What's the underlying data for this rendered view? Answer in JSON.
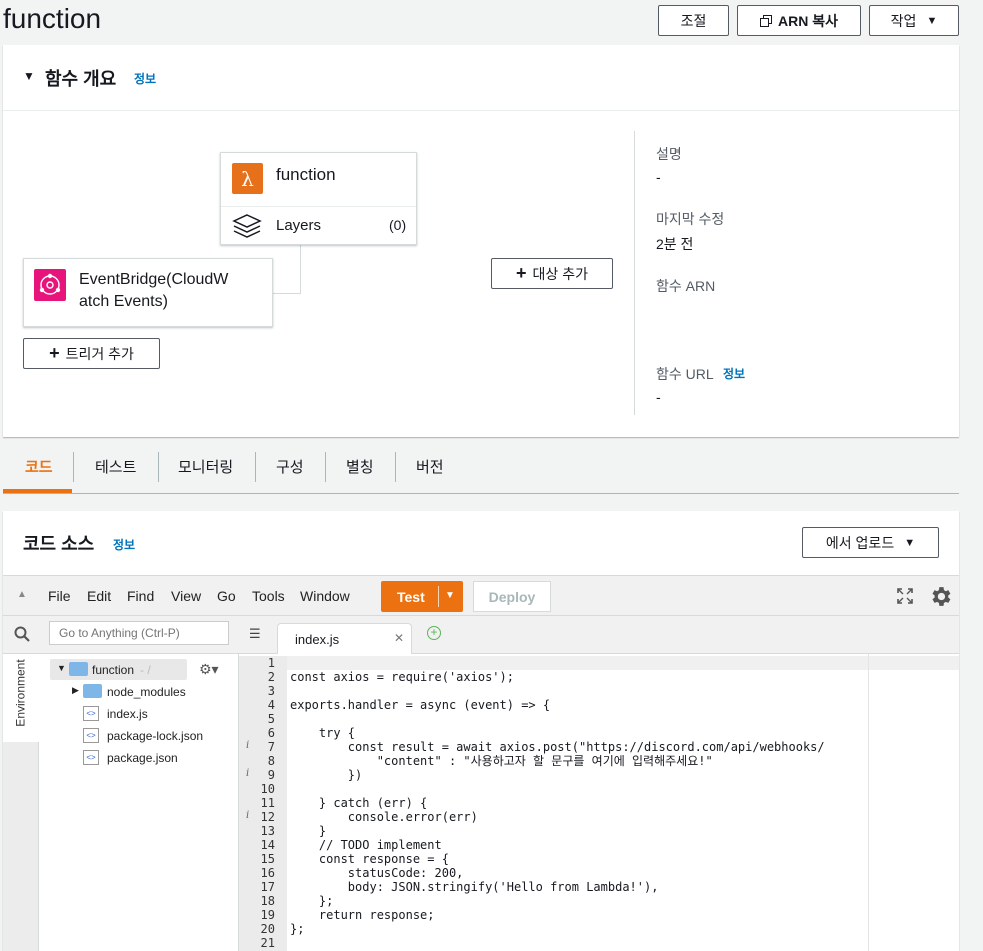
{
  "page": {
    "title": "function"
  },
  "header_buttons": {
    "throttle": "조절",
    "copy_arn": "ARN 복사",
    "actions": "작업"
  },
  "overview": {
    "heading": "함수 개요",
    "info": "정보",
    "function_name": "function",
    "layers_label": "Layers",
    "layers_count": "(0)",
    "trigger_name": "EventBridge(CloudWatch Events)",
    "trigger_line1": "EventBridge(CloudW",
    "trigger_line2": "atch Events)",
    "add_trigger": "트리거 추가",
    "add_destination": "대상 추가",
    "description_label": "설명",
    "description_value": "-",
    "last_modified_label": "마지막 수정",
    "last_modified_value": "2분 전",
    "arn_label": "함수 ARN",
    "url_label": "함수 URL",
    "url_info": "정보",
    "url_value": "-"
  },
  "tabs": [
    "코드",
    "테스트",
    "모니터링",
    "구성",
    "별칭",
    "버전"
  ],
  "code_source": {
    "heading": "코드 소스",
    "info": "정보",
    "upload": "에서 업로드"
  },
  "ide": {
    "menu": [
      "File",
      "Edit",
      "Find",
      "View",
      "Go",
      "Tools",
      "Window"
    ],
    "test": "Test",
    "deploy": "Deploy",
    "search_placeholder": "Go to Anything (Ctrl-P)",
    "environment": "Environment",
    "tab_file": "index.js",
    "tree": {
      "root": "function",
      "root_suffix": "- /",
      "items": [
        "node_modules",
        "index.js",
        "package-lock.json",
        "package.json"
      ]
    }
  },
  "code_lines": [
    "",
    "const axios = require('axios');",
    "",
    "exports.handler = async (event) => {",
    "",
    "    try {",
    "        const result = await axios.post(\"https://discord.com/api/webhooks/",
    "            \"content\" : \"사용하고자 할 문구를 여기에 입력해주세요!\"",
    "        })",
    "",
    "    } catch (err) {",
    "        console.error(err)",
    "    }",
    "    // TODO implement",
    "    const response = {",
    "        statusCode: 200,",
    "        body: JSON.stringify('Hello from Lambda!'),",
    "    };",
    "    return response;",
    "};",
    ""
  ],
  "line_numbers": [
    "1",
    "2",
    "3",
    "4",
    "5",
    "6",
    "7",
    "8",
    "9",
    "10",
    "11",
    "12",
    "13",
    "14",
    "15",
    "16",
    "17",
    "18",
    "19",
    "20",
    "21"
  ],
  "colors": {
    "accent": "#ec7211",
    "link": "#0073bb",
    "lambda": "#e7711b",
    "eventbridge": "#e7157b"
  }
}
